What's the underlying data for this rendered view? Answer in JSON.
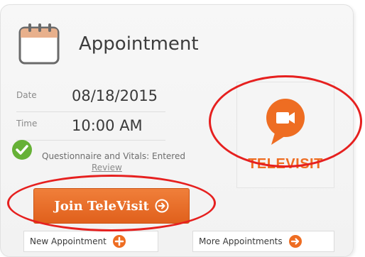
{
  "card": {
    "title": "Appointment",
    "date_label": "Date",
    "date_value": "08/18/2015",
    "time_label": "Time",
    "time_value": "10:00 AM",
    "questionnaire_text": "Questionnaire and Vitals: Entered",
    "review_link": "Review"
  },
  "televisit_tile": {
    "label": "TELEVISIT",
    "icon": "video-camera-chat-icon"
  },
  "actions": {
    "join_label": "Join TeleVisit",
    "new_appointment_label": "New Appointment",
    "more_appointments_label": "More Appointments"
  },
  "colors": {
    "accent_orange": "#ee6d22",
    "status_green": "#66b136",
    "highlight_red": "#e6201f"
  }
}
